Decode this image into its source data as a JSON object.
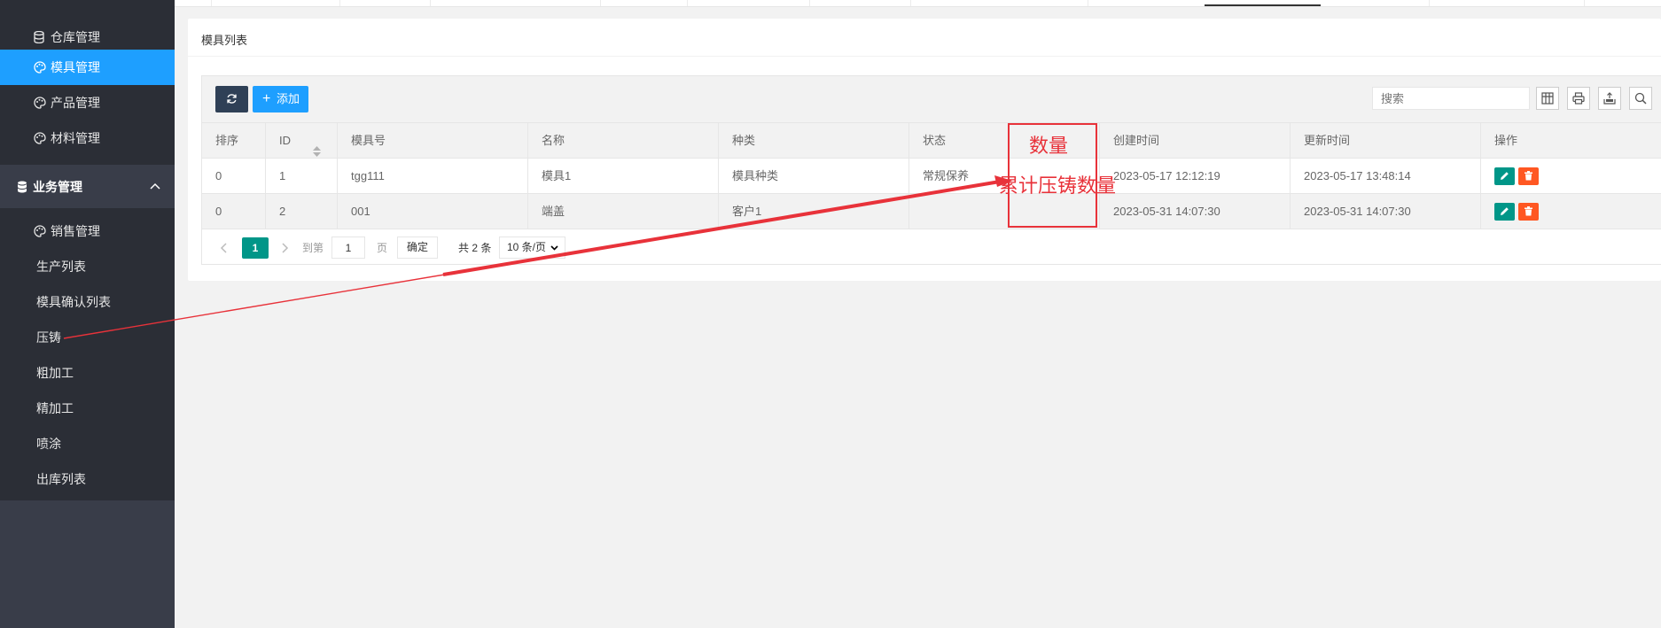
{
  "sidebar": {
    "top_items": [
      {
        "label": "仓库管理",
        "icon": "database-icon"
      },
      {
        "label": "模具管理",
        "icon": "palette-icon",
        "active": true
      },
      {
        "label": "产品管理",
        "icon": "palette-icon"
      },
      {
        "label": "材料管理",
        "icon": "palette-icon"
      }
    ],
    "group": {
      "label": "业务管理",
      "icon": "database-icon",
      "expanded": true
    },
    "sub_items": [
      {
        "label": "销售管理",
        "icon": "palette-icon"
      },
      {
        "label": "生产列表"
      },
      {
        "label": "模具确认列表"
      },
      {
        "label": "压铸"
      },
      {
        "label": "粗加工"
      },
      {
        "label": "精加工"
      },
      {
        "label": "喷涂"
      },
      {
        "label": "出库列表"
      }
    ]
  },
  "card": {
    "title": "模具列表"
  },
  "toolbar": {
    "add_label": "添加",
    "search_placeholder": "搜索"
  },
  "table": {
    "columns": [
      "排序",
      "ID",
      "模具号",
      "名称",
      "种类",
      "状态",
      "",
      "创建时间",
      "更新时间",
      "操作"
    ],
    "rows": [
      {
        "sort": "0",
        "id": "1",
        "code": "tgg111",
        "name": "模具1",
        "kind": "模具种类",
        "status": "常规保养",
        "qty": "",
        "created": "2023-05-17 12:12:19",
        "updated": "2023-05-17 13:48:14"
      },
      {
        "sort": "0",
        "id": "2",
        "code": "001",
        "name": "端盖",
        "kind": "客户1",
        "status": "",
        "qty": "",
        "created": "2023-05-31 14:07:30",
        "updated": "2023-05-31 14:07:30"
      }
    ]
  },
  "pager": {
    "current_page": "1",
    "goto_label": "到第",
    "page_input": "1",
    "page_unit": "页",
    "confirm_label": "确定",
    "total_label": "共 2 条",
    "page_size": "10 条/页"
  },
  "annotation": {
    "label_1": "数量",
    "label_2": "累计压铸数量",
    "color": "#e8323a"
  },
  "colors": {
    "sidebar_bg": "#393d49",
    "sidebar_active": "#1e9fff",
    "edit_button": "#009688",
    "delete_button": "#ff5722",
    "pager_current": "#009688"
  }
}
